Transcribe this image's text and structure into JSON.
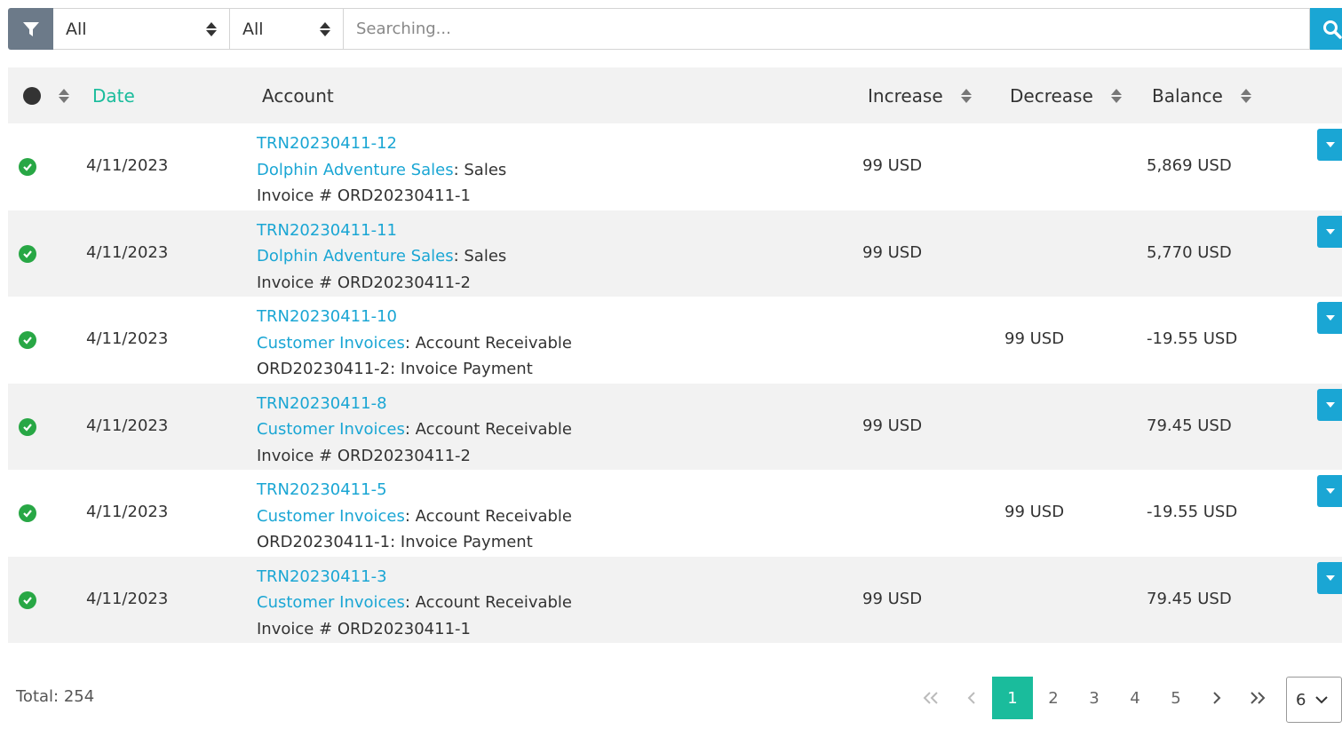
{
  "filter": {
    "select1": {
      "value": "All"
    },
    "select2": {
      "value": "All"
    },
    "search": {
      "placeholder": "Searching..."
    }
  },
  "table": {
    "headers": {
      "date": "Date",
      "account": "Account",
      "increase": "Increase",
      "decrease": "Decrease",
      "balance": "Balance"
    },
    "rows": [
      {
        "date": "4/11/2023",
        "trn": "TRN20230411-12",
        "account_link": "Dolphin Adventure Sales",
        "account_rest": ": Sales",
        "memo": "Invoice # ORD20230411-1",
        "increase": "99 USD",
        "decrease": "",
        "balance": "5,869 USD"
      },
      {
        "date": "4/11/2023",
        "trn": "TRN20230411-11",
        "account_link": "Dolphin Adventure Sales",
        "account_rest": ": Sales",
        "memo": "Invoice # ORD20230411-2",
        "increase": "99 USD",
        "decrease": "",
        "balance": "5,770 USD"
      },
      {
        "date": "4/11/2023",
        "trn": "TRN20230411-10",
        "account_link": "Customer Invoices",
        "account_rest": ": Account Receivable",
        "memo": "ORD20230411-2: Invoice Payment",
        "increase": "",
        "decrease": "99 USD",
        "balance": "-19.55 USD"
      },
      {
        "date": "4/11/2023",
        "trn": "TRN20230411-8",
        "account_link": "Customer Invoices",
        "account_rest": ": Account Receivable",
        "memo": "Invoice # ORD20230411-2",
        "increase": "99 USD",
        "decrease": "",
        "balance": "79.45 USD"
      },
      {
        "date": "4/11/2023",
        "trn": "TRN20230411-5",
        "account_link": "Customer Invoices",
        "account_rest": ": Account Receivable",
        "memo": "ORD20230411-1: Invoice Payment",
        "increase": "",
        "decrease": "99 USD",
        "balance": "-19.55 USD"
      },
      {
        "date": "4/11/2023",
        "trn": "TRN20230411-3",
        "account_link": "Customer Invoices",
        "account_rest": ": Account Receivable",
        "memo": "Invoice # ORD20230411-1",
        "increase": "99 USD",
        "decrease": "",
        "balance": "79.45 USD"
      }
    ]
  },
  "footer": {
    "total": "Total: 254",
    "pages": [
      "1",
      "2",
      "3",
      "4",
      "5"
    ],
    "current_page": "1",
    "page_size": "6"
  },
  "colors": {
    "accent_teal": "#1abc9c",
    "link_blue": "#1aa6d4",
    "success_green": "#28a745",
    "filter_gray": "#6c7a89"
  },
  "icons": {
    "filter": "filter-icon",
    "search": "search-icon",
    "status": "check-circle-icon",
    "sort": "sort-icon",
    "row_menu": "caret-down-icon",
    "first": "double-chevron-left-icon",
    "prev": "chevron-left-icon",
    "next": "chevron-right-icon",
    "last": "double-chevron-right-icon"
  }
}
